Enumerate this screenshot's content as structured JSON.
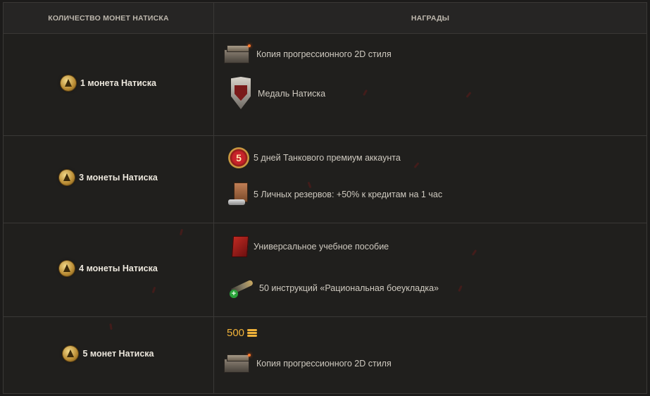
{
  "table": {
    "header_coins": "КОЛИЧЕСТВО МОНЕТ НАТИСКА",
    "header_rewards": "НАГРАДЫ"
  },
  "rows": [
    {
      "coins_label": "1 монета Натиска",
      "rewards": [
        {
          "icon": "chest-icon",
          "text": "Копия прогрессионного 2D стиля"
        },
        {
          "icon": "medal-icon",
          "text": "Медаль Натиска"
        }
      ]
    },
    {
      "coins_label": "3 монеты Натиска",
      "rewards": [
        {
          "icon": "premium-5-days-icon",
          "text": "5 дней Танкового премиум аккаунта",
          "badge": "5"
        },
        {
          "icon": "personal-reserve-icon",
          "text": "5 Личных резервов: +50% к кредитам на 1 час"
        }
      ]
    },
    {
      "coins_label": "4 монеты Натиска",
      "rewards": [
        {
          "icon": "training-manual-icon",
          "text": "Универсальное учебное пособие"
        },
        {
          "icon": "ammo-instruction-icon",
          "text": "50 инструкций «Рациональная боеукладка»"
        }
      ]
    },
    {
      "coins_label": "5 монет Натиска",
      "gold": {
        "amount": "500",
        "icon": "gold-icon"
      },
      "rewards": [
        {
          "icon": "chest-icon",
          "text": "Копия прогрессионного 2D стиля"
        }
      ]
    }
  ],
  "colors": {
    "background": "#1c1b1a",
    "gold": "#f0b23a",
    "text": "#cfcac0"
  }
}
